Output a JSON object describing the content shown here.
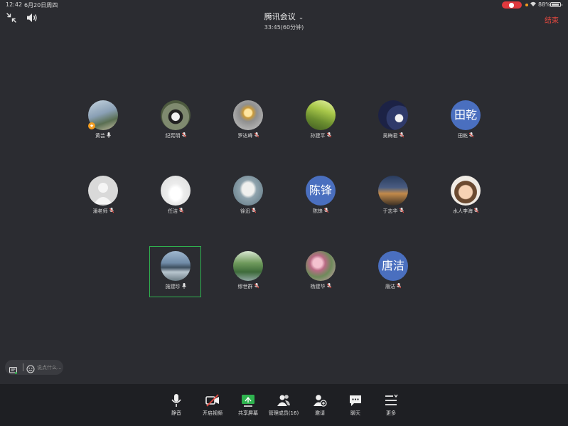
{
  "status_bar": {
    "time": "12:42",
    "date": "6月20日周四",
    "battery": "88%"
  },
  "header": {
    "title": "腾讯会议",
    "timer": "33:45(60分钟)",
    "end_label": "结束"
  },
  "participants": [
    {
      "name": "黄芸",
      "mic": "active",
      "avatar": "photo-landscape",
      "host": true
    },
    {
      "name": "纪宪明",
      "mic": "muted",
      "avatar": "photo-horses"
    },
    {
      "name": "罗达峰",
      "mic": "muted",
      "avatar": "photo-lightbulb"
    },
    {
      "name": "孙建平",
      "mic": "muted",
      "avatar": "photo-tree"
    },
    {
      "name": "吴梅君",
      "mic": "muted",
      "avatar": "photo-night"
    },
    {
      "name": "田乾",
      "mic": "muted",
      "avatar_text": "田乾"
    },
    {
      "name": "潘老师",
      "mic": "muted",
      "avatar": "default-person"
    },
    {
      "name": "任洁",
      "mic": "muted",
      "avatar": "photo-bride"
    },
    {
      "name": "徐迅",
      "mic": "muted",
      "avatar": "photo-seal"
    },
    {
      "name": "陈锋",
      "mic": "muted",
      "avatar_text": "陈锋"
    },
    {
      "name": "于志华",
      "mic": "muted",
      "avatar": "photo-town"
    },
    {
      "name": "水人李海",
      "mic": "muted",
      "avatar": "photo-child"
    },
    {
      "name": "施建珍",
      "mic": "active",
      "avatar": "photo-lake",
      "speaking": true
    },
    {
      "name": "缪世群",
      "mic": "muted",
      "avatar": "photo-forest"
    },
    {
      "name": "杨建华",
      "mic": "muted",
      "avatar": "photo-flowers"
    },
    {
      "name": "唐洁",
      "mic": "muted",
      "avatar_text": "唐洁"
    }
  ],
  "chat": {
    "placeholder": "说点什么..."
  },
  "toolbar": {
    "items": [
      {
        "label": "静音",
        "icon": "microphone-icon"
      },
      {
        "label": "开启视频",
        "icon": "video-off-icon"
      },
      {
        "label": "共享屏幕",
        "icon": "share-screen-icon"
      },
      {
        "label": "管理成员(16)",
        "icon": "members-icon"
      },
      {
        "label": "邀请",
        "icon": "invite-icon"
      },
      {
        "label": "聊天",
        "icon": "chat-icon"
      },
      {
        "label": "更多",
        "icon": "more-icon"
      }
    ]
  },
  "colors": {
    "background": "#2b2c31",
    "toolbar_bg": "#1e1f23",
    "end_red": "#e5483f",
    "speaking_green": "#2fb34f",
    "text_avatar_blue": "#4a6fbf"
  }
}
